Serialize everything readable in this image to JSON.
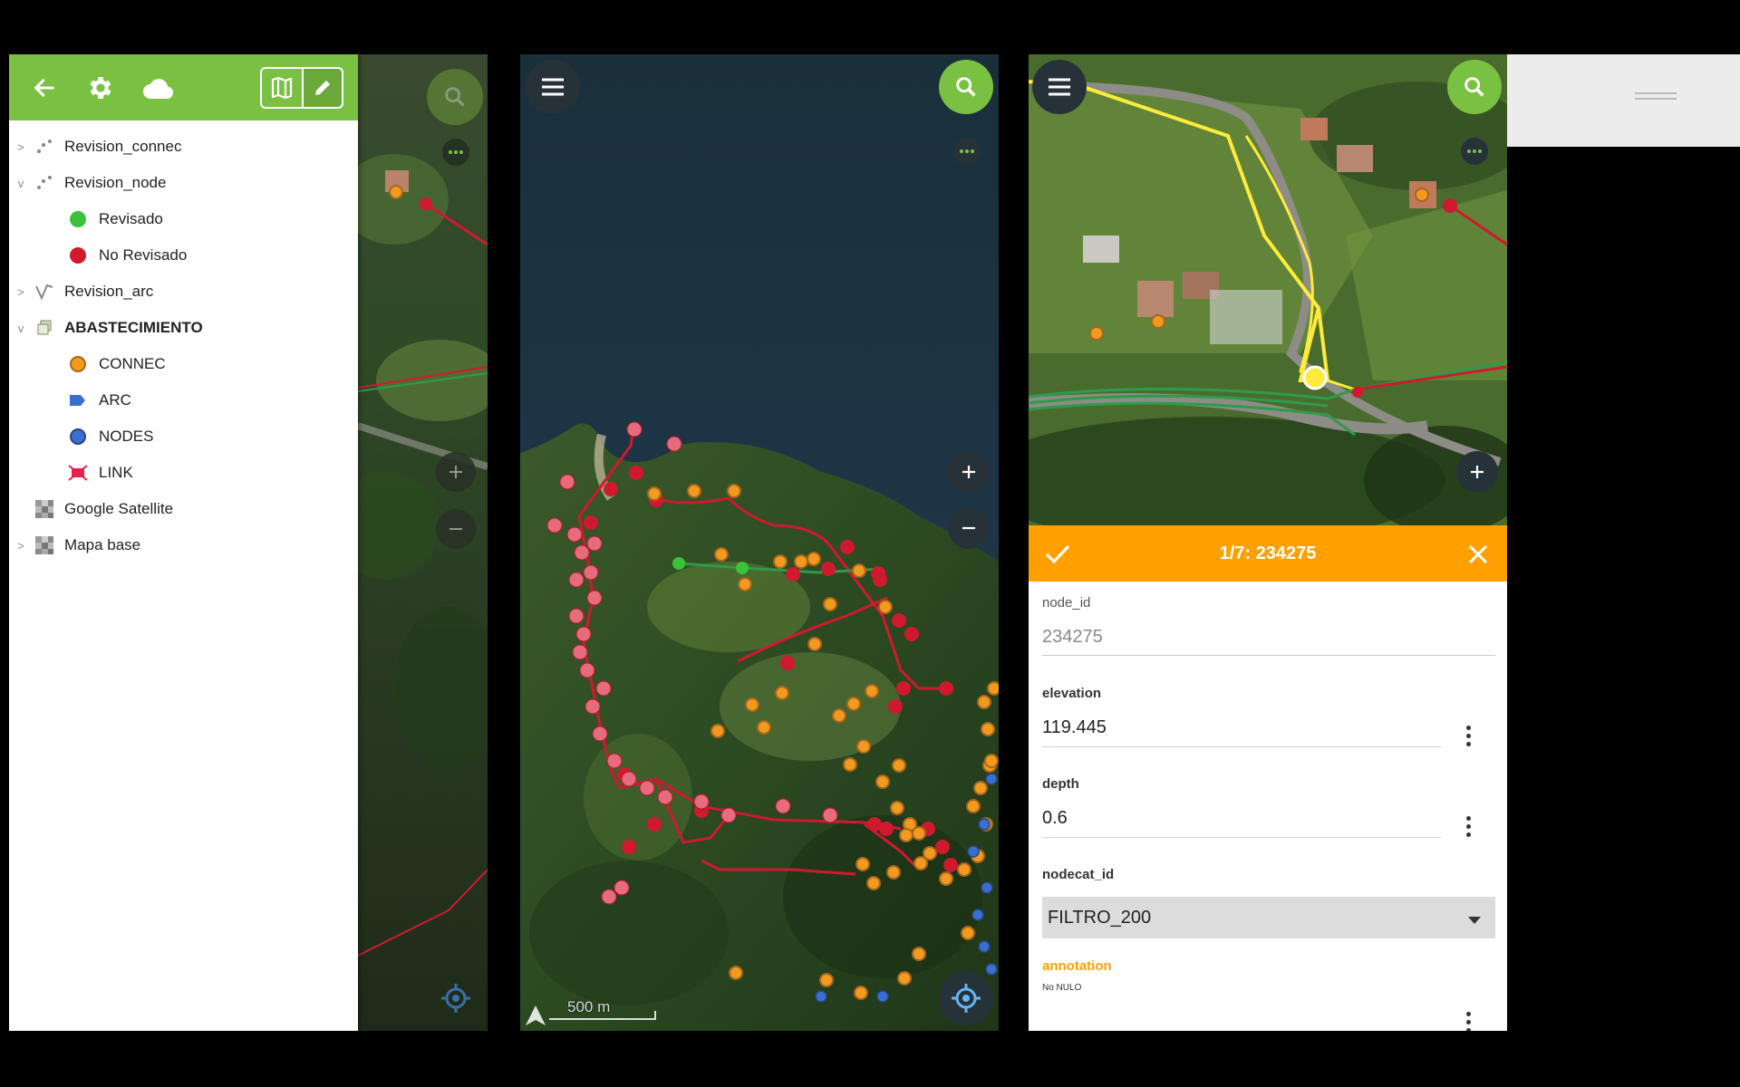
{
  "panel1": {
    "drawer": {
      "back_icon": "arrow-left-icon",
      "settings_icon": "gear-icon",
      "cloud_icon": "cloud-icon",
      "map_mode_icon": "map-icon",
      "edit_mode_icon": "pencil-icon",
      "layers": [
        {
          "label": "Revision_connec",
          "chevron": ">",
          "icon": "point-layer-icon"
        },
        {
          "label": "Revision_node",
          "chevron": "v",
          "icon": "point-layer-icon"
        },
        {
          "label": "Revisado",
          "icon": "green-dot",
          "color": "#3cc13b"
        },
        {
          "label": "No Revisado",
          "icon": "red-dot",
          "color": "#d0192f"
        },
        {
          "label": "Revision_arc",
          "chevron": ">",
          "icon": "line-layer-icon"
        },
        {
          "label": "ABASTECIMIENTO",
          "chevron": "v",
          "icon": "group-icon"
        },
        {
          "label": "CONNEC",
          "icon": "orange-dot",
          "color": "#f29a1f"
        },
        {
          "label": "ARC",
          "icon": "arc-symbol",
          "color": "#3a6ed0"
        },
        {
          "label": "NODES",
          "icon": "blue-dot",
          "color": "#3a6ed0"
        },
        {
          "label": "LINK",
          "icon": "link-symbol",
          "color": "#e4204e"
        },
        {
          "label": "Google Satellite",
          "icon": "raster-icon"
        },
        {
          "label": "Mapa base",
          "chevron": ">",
          "icon": "raster-icon"
        }
      ]
    }
  },
  "panel2": {
    "scale_label": "500 m"
  },
  "panel3": {
    "form_title": "1/7: 234275",
    "fields": {
      "node_id_label": "node_id",
      "node_id_value": "234275",
      "elevation_label": "elevation",
      "elevation_value": "119.445",
      "depth_label": "depth",
      "depth_value": "0.6",
      "nodecat_label": "nodecat_id",
      "nodecat_value": "FILTRO_200",
      "annotation_label": "annotation",
      "annotation_hint": "No NULO"
    }
  },
  "colors": {
    "qfield_green": "#7ac143",
    "form_orange": "#ffa000",
    "reviewed": "#3cc13b",
    "not_reviewed": "#d0192f",
    "connec": "#f29a1f"
  }
}
